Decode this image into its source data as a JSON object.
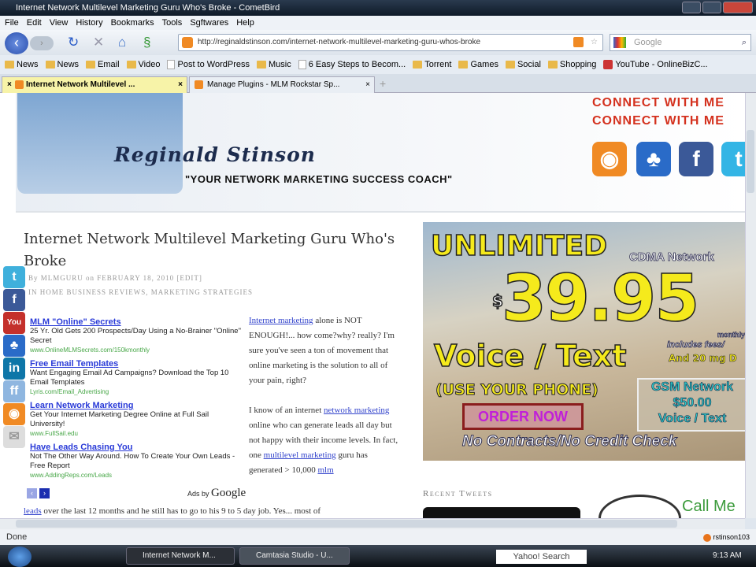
{
  "window": {
    "title": "Internet Network Multilevel Marketing Guru Who's Broke - CometBird"
  },
  "menu": [
    "File",
    "Edit",
    "View",
    "History",
    "Bookmarks",
    "Tools",
    "Sgftwares",
    "Help"
  ],
  "nav": {
    "url": "http://reginaldstinson.com/internet-network-multilevel-marketing-guru-whos-broke",
    "search_placeholder": "Google"
  },
  "bookmarks": [
    {
      "label": "News",
      "icon": "folder"
    },
    {
      "label": "News",
      "icon": "folder"
    },
    {
      "label": "Email",
      "icon": "folder"
    },
    {
      "label": "Video",
      "icon": "folder"
    },
    {
      "label": "Post to WordPress",
      "icon": "page"
    },
    {
      "label": "Music",
      "icon": "folder"
    },
    {
      "label": "6 Easy Steps to Becom...",
      "icon": "page"
    },
    {
      "label": "Torrent",
      "icon": "folder"
    },
    {
      "label": "Games",
      "icon": "folder"
    },
    {
      "label": "Social",
      "icon": "folder"
    },
    {
      "label": "Shopping",
      "icon": "folder"
    },
    {
      "label": "YouTube - OnlineBizC...",
      "icon": "youtube"
    }
  ],
  "tabs": [
    {
      "label": "Internet Network Multilevel ...",
      "active": true
    },
    {
      "label": "Manage Plugins - MLM Rockstar Sp...",
      "active": false
    }
  ],
  "header": {
    "connect": "CONNECT WITH ME",
    "name": "Reginald Stinson",
    "tagline": "\"YOUR NETWORK MARKETING SUCCESS COACH\""
  },
  "post": {
    "title": "Internet Network Multilevel Marketing Guru Who's Broke",
    "byline": "By MLMGURU on FEBRUARY 18, 2010   [EDIT]",
    "categories": "IN HOME BUSINESS REVIEWS, MARKETING STRATEGIES",
    "ads": [
      {
        "title": "MLM \"Online\" Secrets",
        "desc": "25 Yr. Old Gets 200 Prospects/Day Using a No-Brainer \"Online\" Secret",
        "url": "www.OnlineMLMSecrets.com/150kmonthly"
      },
      {
        "title": "Free Email Templates",
        "desc": "Want Engaging Email Ad Campaigns? Download the Top 10 Email Templates",
        "url": "Lyris.com/Email_Advertising"
      },
      {
        "title": "Learn Network Marketing",
        "desc": "Get Your Internet Marketing Degree Online at Full Sail University!",
        "url": "www.FullSail.edu"
      },
      {
        "title": "Have Leads Chasing You",
        "desc": "Not The Other Way Around. How To Create Your Own Leads - Free Report",
        "url": "www.AddingReps.com/Leads"
      }
    ],
    "ads_by": "Ads by",
    "google": "Google",
    "p1_link": "Internet marketing",
    "p1": " alone is NOT ENOUGH!... how come?why? really? I'm sure you've seen a ton of movement that online marketing is the solution to all of your pain, right?",
    "p2a": "I know of an internet ",
    "p2_link1": "network marketing",
    "p2b": " online who can generate leads all day but not happy with their income levels. In fact, one ",
    "p2_link2": "multilevel marketing",
    "p2c": " guru has generated > 10,000 ",
    "p2_link3": "mlm",
    "last_link": "leads",
    "last": " over the last 12 months and he still has to go to his 9 to 5 day job. Yes... most of"
  },
  "promo": {
    "unlimited": "UNLIMITED",
    "cdma": "CDMA Network",
    "dollar": "$",
    "price": "39.95",
    "monthly": "monthly",
    "voice_text": "Voice / Text",
    "includes": "includes fees/",
    "and20": "And 20 mg D",
    "use_phone": "(USE YOUR PHONE)",
    "order": "ORDER NOW",
    "gsm": "GSM Network",
    "gsm_price": "$50.00",
    "gsm_vt": "Voice / Text",
    "no_contracts": "No Contracts/No Credit Check"
  },
  "sidebar": {
    "recent_tweets": "Recent Tweets",
    "call_me": "Call Me"
  },
  "status": {
    "text": "Done",
    "user": "rstinson103"
  },
  "taskbar": {
    "tasks": [
      "Internet Network M...",
      "Camtasia Studio - U..."
    ],
    "search": "Yahoo! Search",
    "clock": "9:13 AM"
  }
}
